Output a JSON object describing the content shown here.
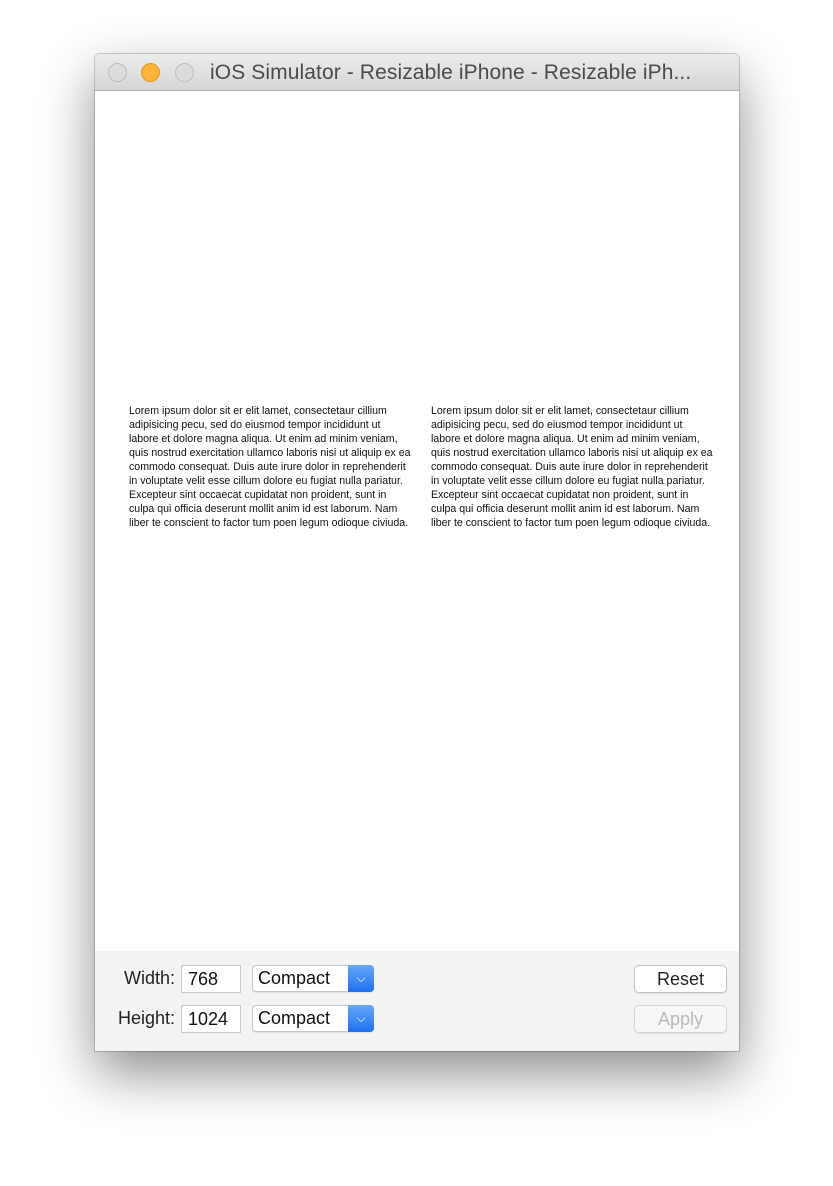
{
  "window": {
    "title": "iOS Simulator - Resizable iPhone - Resizable iPh...",
    "accent_color": "#fcb43a"
  },
  "content": {
    "left_text": "Lorem ipsum dolor sit er elit lamet, consectetaur cillium adipisicing pecu, sed do eiusmod tempor incididunt ut labore et dolore magna aliqua. Ut enim ad minim veniam, quis nostrud exercitation ullamco laboris nisi ut aliquip ex ea commodo consequat. Duis aute irure dolor in reprehenderit in voluptate velit esse cillum dolore eu fugiat nulla pariatur. Excepteur sint occaecat cupidatat non proident, sunt in culpa qui officia deserunt mollit anim id est laborum. Nam liber te conscient to factor tum poen legum odioque civiuda.",
    "right_text": "Lorem ipsum dolor sit er elit lamet, consectetaur cillium adipisicing pecu, sed do eiusmod tempor incididunt ut labore et dolore magna aliqua. Ut enim ad minim veniam, quis nostrud exercitation ullamco laboris nisi ut aliquip ex ea commodo consequat. Duis aute irure dolor in reprehenderit in voluptate velit esse cillum dolore eu fugiat nulla pariatur. Excepteur sint occaecat cupidatat non proident, sunt in culpa qui officia deserunt mollit anim id est laborum. Nam liber te conscient to factor tum poen legum odioque civiuda."
  },
  "controls": {
    "width_label": "Width:",
    "width_value": "768",
    "width_class": "Compact",
    "height_label": "Height:",
    "height_value": "1024",
    "height_class": "Compact",
    "reset_label": "Reset",
    "apply_label": "Apply",
    "select_arrow_icon": "chevron-down-icon",
    "select_color": "#1f6ff0"
  }
}
